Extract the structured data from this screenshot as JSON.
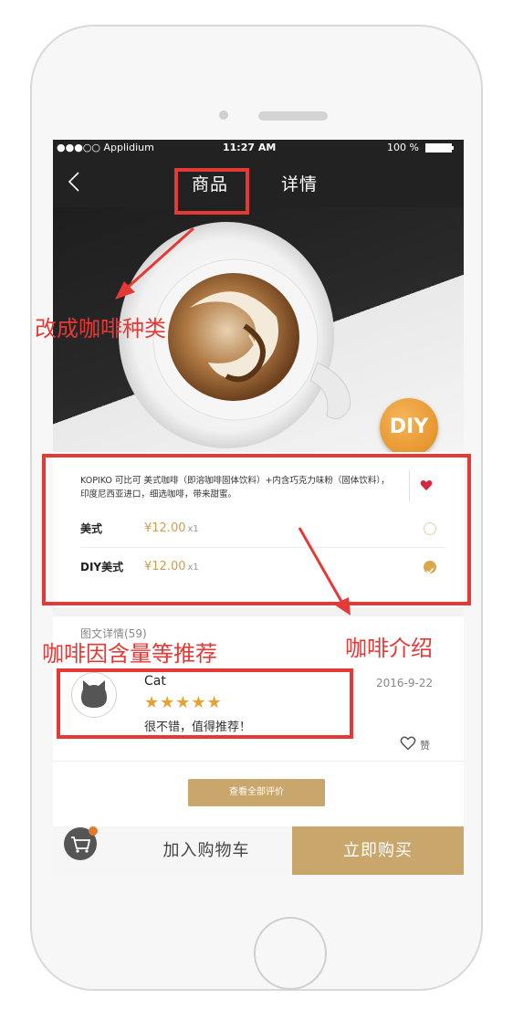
{
  "status_bar": {
    "carrier": "●●●○○ Applidium",
    "time": "11:27 AM",
    "battery": "100 %"
  },
  "nav": {
    "tabs": [
      {
        "label": "商品",
        "active": true
      },
      {
        "label": "详情",
        "active": false
      }
    ]
  },
  "hero": {
    "diy_label": "DIY"
  },
  "product": {
    "description": "KOPIKO 可比可 美式咖啡（即溶咖啡固体饮料）+内含巧克力味粉（固体饮料），印度尼西亚进口，细选咖啡，带来甜蜜。",
    "options": [
      {
        "name": "美式",
        "price": "¥12.00",
        "qty": "x1",
        "selected": false
      },
      {
        "name": "DIY美式",
        "price": "¥12.00",
        "qty": "x1",
        "selected": true
      }
    ]
  },
  "reviews": {
    "header": "图文详情(59)",
    "items": [
      {
        "user": "Cat",
        "stars": "★★★★★",
        "text": "很不错，值得推荐！",
        "date": "2016-9-22",
        "like_label": "赞"
      }
    ],
    "view_all_label": "查看全部评价"
  },
  "bottom_bar": {
    "add_to_cart": "加入购物车",
    "buy_now": "立即购买"
  },
  "annotations": {
    "tab_note": "改成咖啡种类",
    "intro_note": "咖啡介绍",
    "review_note": "咖啡因含量等推荐"
  },
  "colors": {
    "accent": "#c9a66b",
    "price": "#c9a14e",
    "star": "#e7a230",
    "annotation": "#e53935",
    "heart": "#d7263d"
  }
}
